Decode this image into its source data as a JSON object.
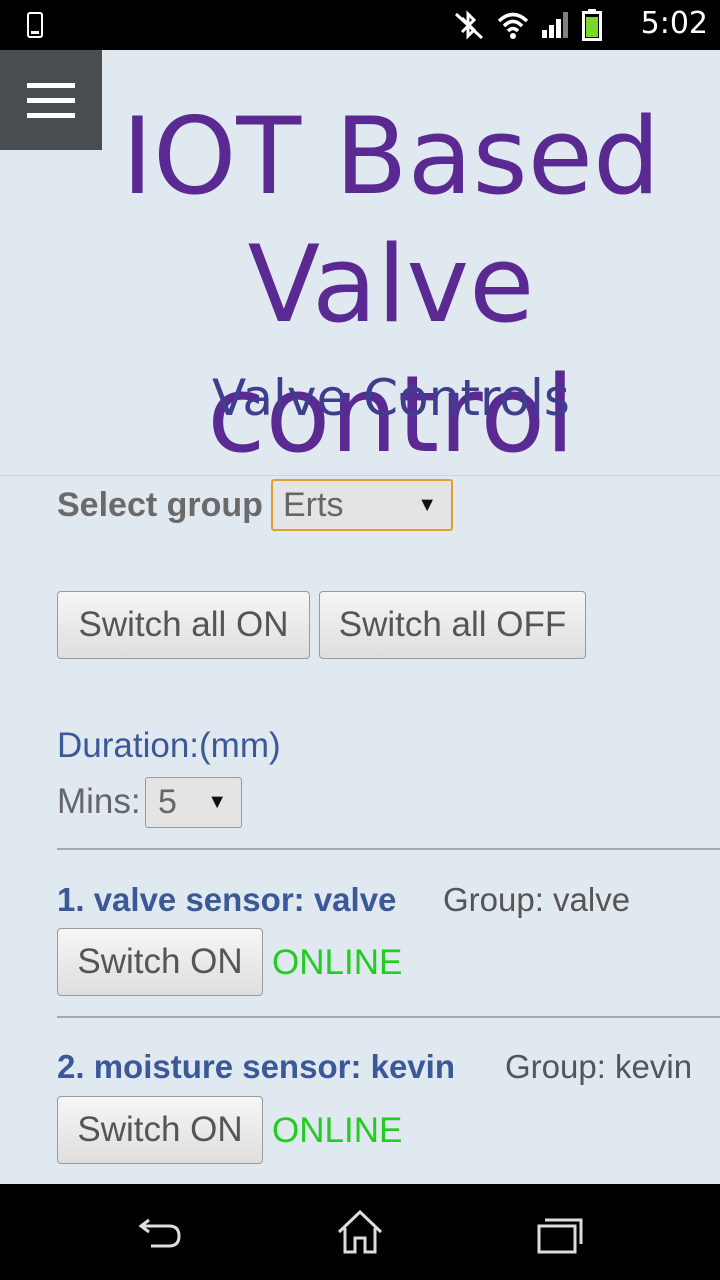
{
  "status_bar": {
    "time": "5:02"
  },
  "header": {
    "title_line1": "IOT Based",
    "title_line2": "Valve control",
    "subtitle": "Valve Controls"
  },
  "group_select": {
    "label": "Select group",
    "value": "Erts"
  },
  "bulk_actions": {
    "all_on": "Switch all ON",
    "all_off": "Switch all OFF"
  },
  "duration": {
    "label": "Duration:(mm)",
    "mins_label": "Mins:",
    "mins_value": "5"
  },
  "sensors": [
    {
      "name": "1. valve sensor: valve",
      "group": "Group: valve",
      "button": "Switch ON",
      "status": "ONLINE"
    },
    {
      "name": "2. moisture sensor: kevin",
      "group": "Group: kevin",
      "button": "Switch ON",
      "status": "ONLINE"
    }
  ],
  "colors": {
    "title": "#5a2a92",
    "subtitle": "#3e3d8e",
    "link": "#3b5998",
    "online": "#22cc22",
    "background": "#e0e8f0"
  },
  "icons": [
    "phone-icon",
    "bluetooth-off-icon",
    "wifi-icon",
    "signal-icon",
    "battery-icon",
    "menu-icon",
    "back-icon",
    "home-icon",
    "recents-icon"
  ]
}
